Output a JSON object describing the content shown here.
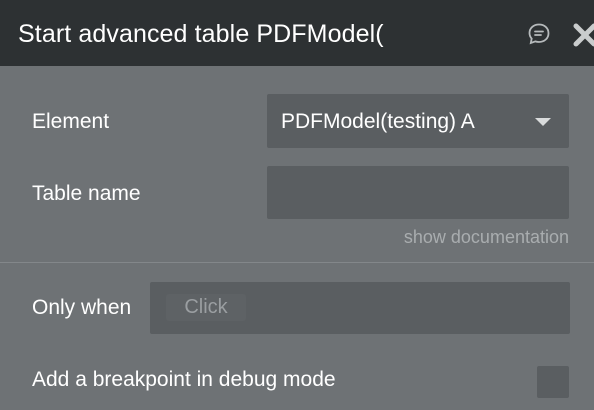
{
  "header": {
    "title": "Start advanced table PDFModel(",
    "comment_icon": "chat-bubble-icon",
    "close_icon": "close-icon"
  },
  "fields": {
    "element_label": "Element",
    "element_value": "PDFModel(testing) A",
    "table_name_label": "Table name",
    "table_name_value": "",
    "show_documentation": "show documentation"
  },
  "condition": {
    "only_when_label": "Only when",
    "only_when_placeholder": "Click"
  },
  "debug": {
    "breakpoint_label": "Add a breakpoint in debug mode",
    "breakpoint_checked": false
  },
  "colors": {
    "header_bg": "#2d3133",
    "panel_bg": "#6e7275",
    "input_bg": "#5a5e61",
    "muted_text": "#a9adaf"
  }
}
